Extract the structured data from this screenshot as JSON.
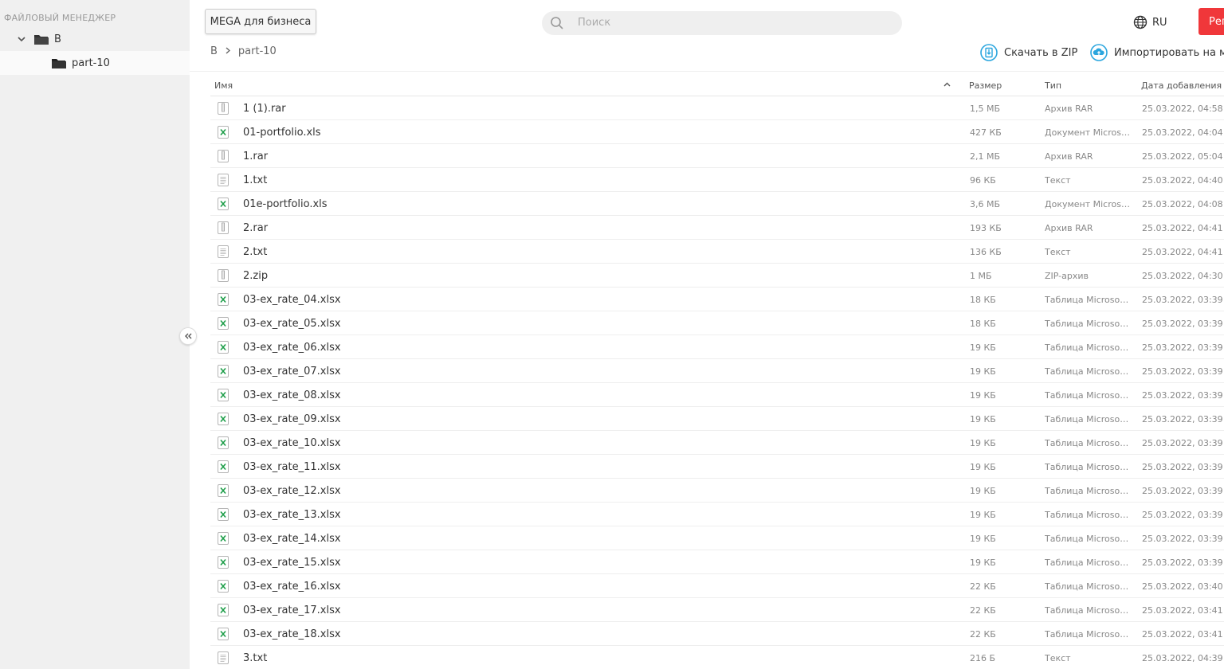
{
  "sidebar": {
    "title": "ФАЙЛОВЫЙ МЕНЕДЖЕР",
    "root": {
      "label": "B",
      "icon": "folder-icon"
    },
    "child": {
      "label": "part-10",
      "icon": "folder-icon"
    },
    "collapse_icon": "double-chevron-left-icon"
  },
  "header": {
    "business_button": "MEGA для бизнеса",
    "search_placeholder": "Поиск",
    "language": "RU",
    "register_button": "Рег",
    "accent_color": "#f0373a"
  },
  "breadcrumb": {
    "root": "B",
    "current": "part-10"
  },
  "actions": {
    "download_zip": "Скачать в ZIP",
    "import": "Импортировать на мой"
  },
  "table": {
    "columns": {
      "name": "Имя",
      "size": "Размер",
      "type": "Тип",
      "date": "Дата добавления"
    },
    "rows": [
      {
        "name": "1 (1).rar",
        "size": "1,5 МБ",
        "type": "Архив RAR",
        "date": "25.03.2022, 04:58",
        "icon": "archive"
      },
      {
        "name": "01-portfolio.xls",
        "size": "427 КБ",
        "type": "Документ Microsoft Excel",
        "date": "25.03.2022, 04:04",
        "icon": "excel"
      },
      {
        "name": "1.rar",
        "size": "2,1 МБ",
        "type": "Архив RAR",
        "date": "25.03.2022, 05:04",
        "icon": "archive"
      },
      {
        "name": "1.txt",
        "size": "96 КБ",
        "type": "Текст",
        "date": "25.03.2022, 04:40",
        "icon": "text"
      },
      {
        "name": "01e-portfolio.xls",
        "size": "3,6 МБ",
        "type": "Документ Microsoft Excel",
        "date": "25.03.2022, 04:08",
        "icon": "excel"
      },
      {
        "name": "2.rar",
        "size": "193 КБ",
        "type": "Архив RAR",
        "date": "25.03.2022, 04:41",
        "icon": "archive"
      },
      {
        "name": "2.txt",
        "size": "136 КБ",
        "type": "Текст",
        "date": "25.03.2022, 04:41",
        "icon": "text"
      },
      {
        "name": "2.zip",
        "size": "1 МБ",
        "type": "ZIP-архив",
        "date": "25.03.2022, 04:30",
        "icon": "archive"
      },
      {
        "name": "03-ex_rate_04.xlsx",
        "size": "18 КБ",
        "type": "Таблица Microsoft Excel",
        "date": "25.03.2022, 03:39",
        "icon": "excel"
      },
      {
        "name": "03-ex_rate_05.xlsx",
        "size": "18 КБ",
        "type": "Таблица Microsoft Excel",
        "date": "25.03.2022, 03:39",
        "icon": "excel"
      },
      {
        "name": "03-ex_rate_06.xlsx",
        "size": "19 КБ",
        "type": "Таблица Microsoft Excel",
        "date": "25.03.2022, 03:39",
        "icon": "excel"
      },
      {
        "name": "03-ex_rate_07.xlsx",
        "size": "19 КБ",
        "type": "Таблица Microsoft Excel",
        "date": "25.03.2022, 03:39",
        "icon": "excel"
      },
      {
        "name": "03-ex_rate_08.xlsx",
        "size": "19 КБ",
        "type": "Таблица Microsoft Excel",
        "date": "25.03.2022, 03:39",
        "icon": "excel"
      },
      {
        "name": "03-ex_rate_09.xlsx",
        "size": "19 КБ",
        "type": "Таблица Microsoft Excel",
        "date": "25.03.2022, 03:39",
        "icon": "excel"
      },
      {
        "name": "03-ex_rate_10.xlsx",
        "size": "19 КБ",
        "type": "Таблица Microsoft Excel",
        "date": "25.03.2022, 03:39",
        "icon": "excel"
      },
      {
        "name": "03-ex_rate_11.xlsx",
        "size": "19 КБ",
        "type": "Таблица Microsoft Excel",
        "date": "25.03.2022, 03:39",
        "icon": "excel"
      },
      {
        "name": "03-ex_rate_12.xlsx",
        "size": "19 КБ",
        "type": "Таблица Microsoft Excel",
        "date": "25.03.2022, 03:39",
        "icon": "excel"
      },
      {
        "name": "03-ex_rate_13.xlsx",
        "size": "19 КБ",
        "type": "Таблица Microsoft Excel",
        "date": "25.03.2022, 03:39",
        "icon": "excel"
      },
      {
        "name": "03-ex_rate_14.xlsx",
        "size": "19 КБ",
        "type": "Таблица Microsoft Excel",
        "date": "25.03.2022, 03:39",
        "icon": "excel"
      },
      {
        "name": "03-ex_rate_15.xlsx",
        "size": "19 КБ",
        "type": "Таблица Microsoft Excel",
        "date": "25.03.2022, 03:39",
        "icon": "excel"
      },
      {
        "name": "03-ex_rate_16.xlsx",
        "size": "22 КБ",
        "type": "Таблица Microsoft Excel",
        "date": "25.03.2022, 03:40",
        "icon": "excel"
      },
      {
        "name": "03-ex_rate_17.xlsx",
        "size": "22 КБ",
        "type": "Таблица Microsoft Excel",
        "date": "25.03.2022, 03:41",
        "icon": "excel"
      },
      {
        "name": "03-ex_rate_18.xlsx",
        "size": "22 КБ",
        "type": "Таблица Microsoft Excel",
        "date": "25.03.2022, 03:41",
        "icon": "excel"
      },
      {
        "name": "3.txt",
        "size": "216 Б",
        "type": "Текст",
        "date": "25.03.2022, 04:39",
        "icon": "text"
      }
    ]
  }
}
